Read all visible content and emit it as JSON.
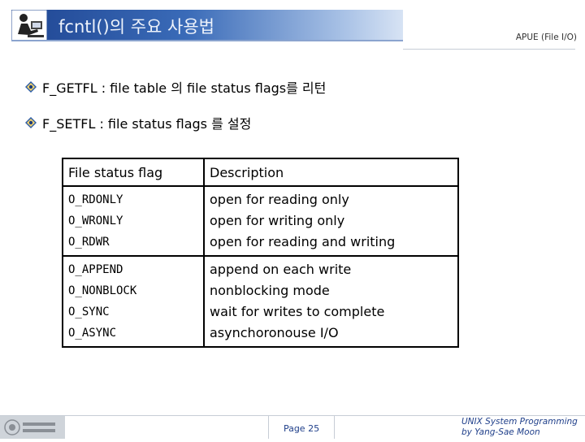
{
  "header": {
    "title": "fcntl()의 주요 사용법",
    "subtitle_right": "APUE (File I/O)"
  },
  "bullets": [
    {
      "text": "F_GETFL : file table 의 file status flags를 리턴"
    },
    {
      "text": "F_SETFL : file status flags 를 설정"
    }
  ],
  "table": {
    "headers": [
      "File status flag",
      "Description"
    ],
    "groups": [
      {
        "flags": [
          "O_RDONLY",
          "O_WRONLY",
          "O_RDWR"
        ],
        "descriptions": [
          "open for reading only",
          "open for writing only",
          "open for reading and writing"
        ]
      },
      {
        "flags": [
          "O_APPEND",
          "O_NONBLOCK",
          "O_SYNC",
          "O_ASYNC"
        ],
        "descriptions": [
          "append on each write",
          "nonblocking mode",
          "wait for writes to complete",
          "asynchoronouse I/O"
        ]
      }
    ]
  },
  "footer": {
    "page": "Page 25",
    "course_line1": "UNIX System Programming",
    "course_line2": "by Yang-Sae Moon"
  },
  "colors": {
    "title_bar": "#1f4592",
    "footer_text": "#1f3f8a"
  },
  "icons": {
    "title": "person-at-computer-icon",
    "bullet": "diamond-bullet-icon",
    "footer_logo": "university-logo-icon"
  }
}
